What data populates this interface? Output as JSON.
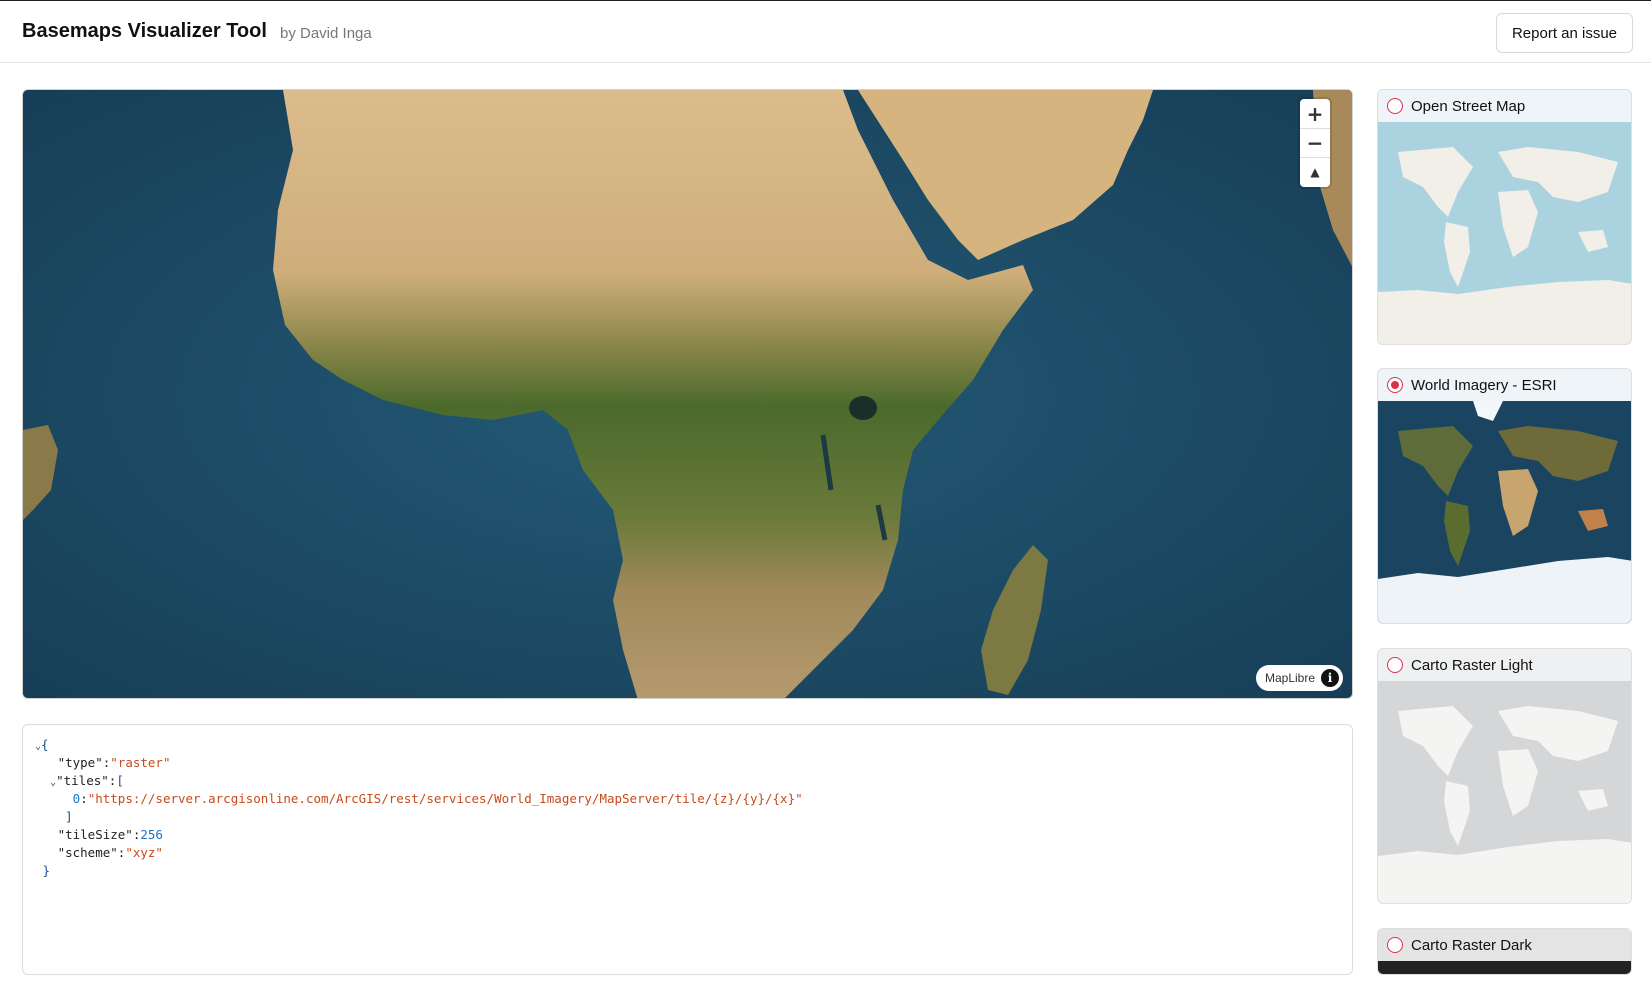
{
  "header": {
    "title": "Basemaps Visualizer Tool",
    "byline": "by David Inga",
    "report_button": "Report an issue"
  },
  "map": {
    "zoom_in_icon": "+",
    "zoom_out_icon": "−",
    "compass_icon": "▲",
    "attribution": "MapLibre",
    "info_icon": "i",
    "colors": {
      "ocean": "#1c4a64",
      "desert": "#d9b98a",
      "forest": "#4d6a2e",
      "savanna": "#8f8a4a"
    }
  },
  "code": {
    "lines": {
      "open": "{",
      "type_key": "\"type\"",
      "type_val": "\"raster\"",
      "tiles_key": "\"tiles\"",
      "tiles_open": "[",
      "tile0_idx": "0",
      "tile0_val": "\"https://server.arcgisonline.com/ArcGIS/rest/services/World_Imagery/MapServer/tile/{z}/{y}/{x}\"",
      "tiles_close": "]",
      "tilesize_key": "\"tileSize\"",
      "tilesize_val": "256",
      "scheme_key": "\"scheme\"",
      "scheme_val": "\"xyz\"",
      "close": "}"
    }
  },
  "basemaps": [
    {
      "label": "Open Street Map",
      "selected": false
    },
    {
      "label": "World Imagery - ESRI",
      "selected": true
    },
    {
      "label": "Carto Raster Light",
      "selected": false
    },
    {
      "label": "Carto Raster Dark",
      "selected": false
    }
  ]
}
